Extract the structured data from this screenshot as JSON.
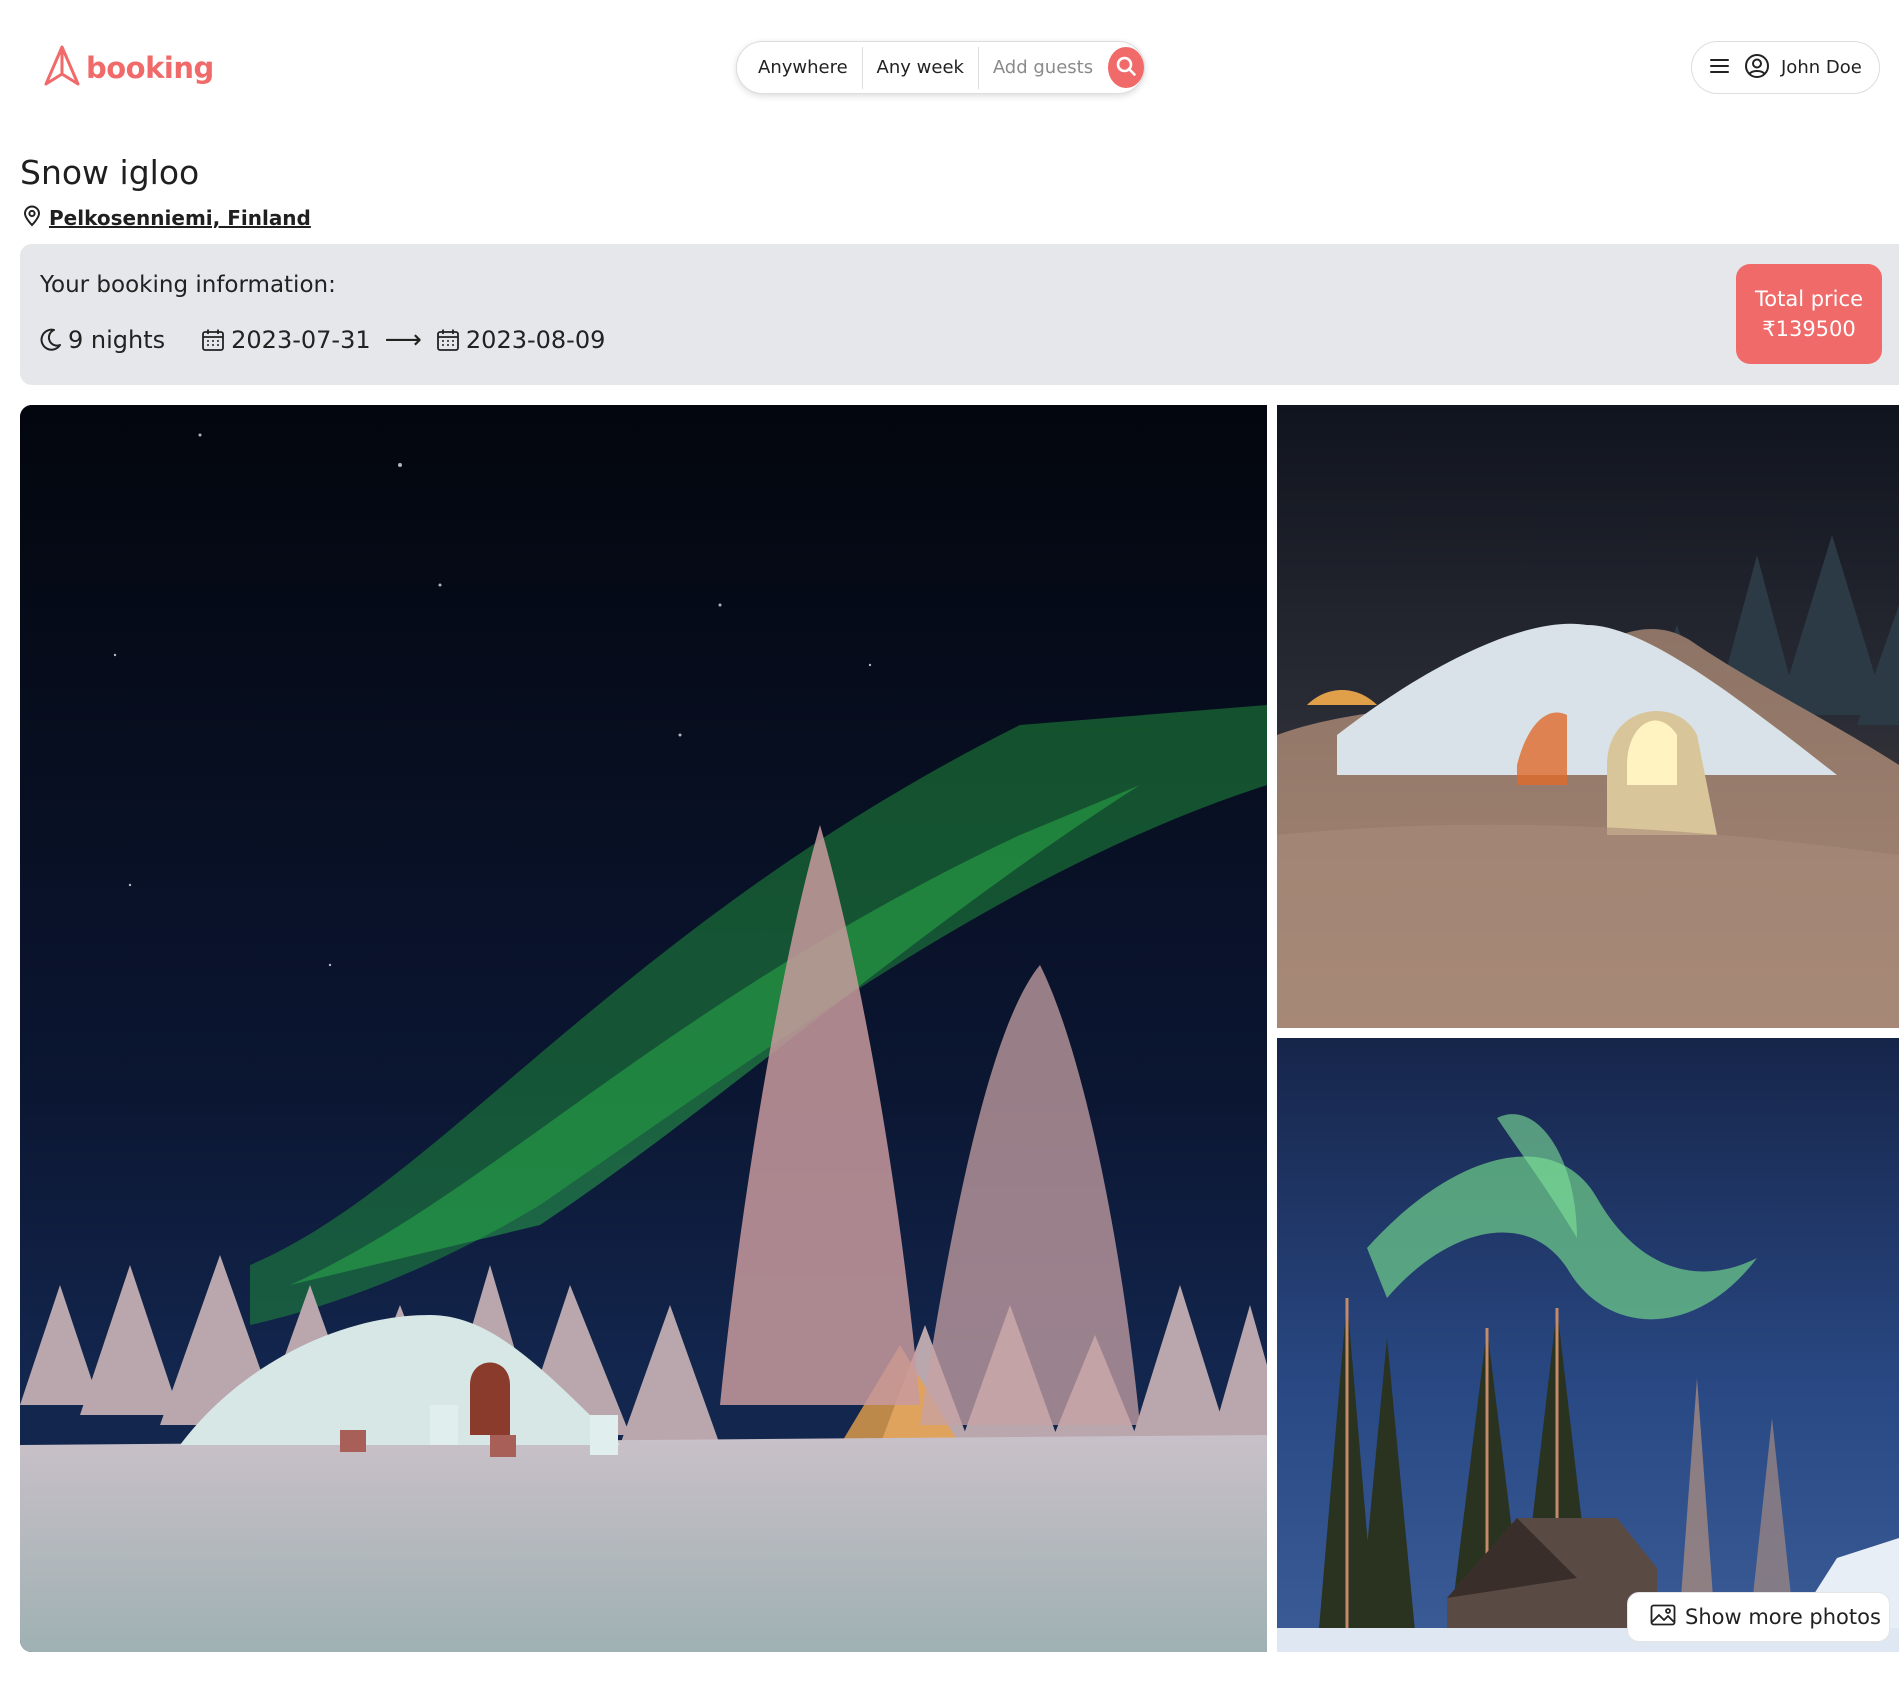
{
  "brand": {
    "name": "booking",
    "accent": "#f06a6a"
  },
  "search": {
    "where": "Anywhere",
    "when": "Any week",
    "guests": "Add guests"
  },
  "user": {
    "name": "John Doe"
  },
  "listing": {
    "title": "Snow igloo",
    "location": "Pelkosenniemi, Finland"
  },
  "booking": {
    "heading": "Your booking information:",
    "nights": "9 nights",
    "check_in": "2023-07-31",
    "arrow": "⟶",
    "check_out": "2023-08-09",
    "total_label": "Total price",
    "total_value": "₹139500"
  },
  "gallery": {
    "more_label": "Show more photos",
    "photos": [
      {
        "name": "main",
        "subject": "snow igloo under aurora with frosted trees"
      },
      {
        "name": "top-right",
        "subject": "lit snow igloo entrance at night"
      },
      {
        "name": "bottom-right",
        "subject": "aurora over pine trees and cabin"
      }
    ]
  },
  "icons": {
    "logo": "booking-logo-icon",
    "search": "search-icon",
    "menu": "menu-icon",
    "user": "user-circle-icon",
    "location": "map-pin-icon",
    "nights": "moon-icon",
    "date": "calendar-icon",
    "gallery": "image-icon"
  }
}
